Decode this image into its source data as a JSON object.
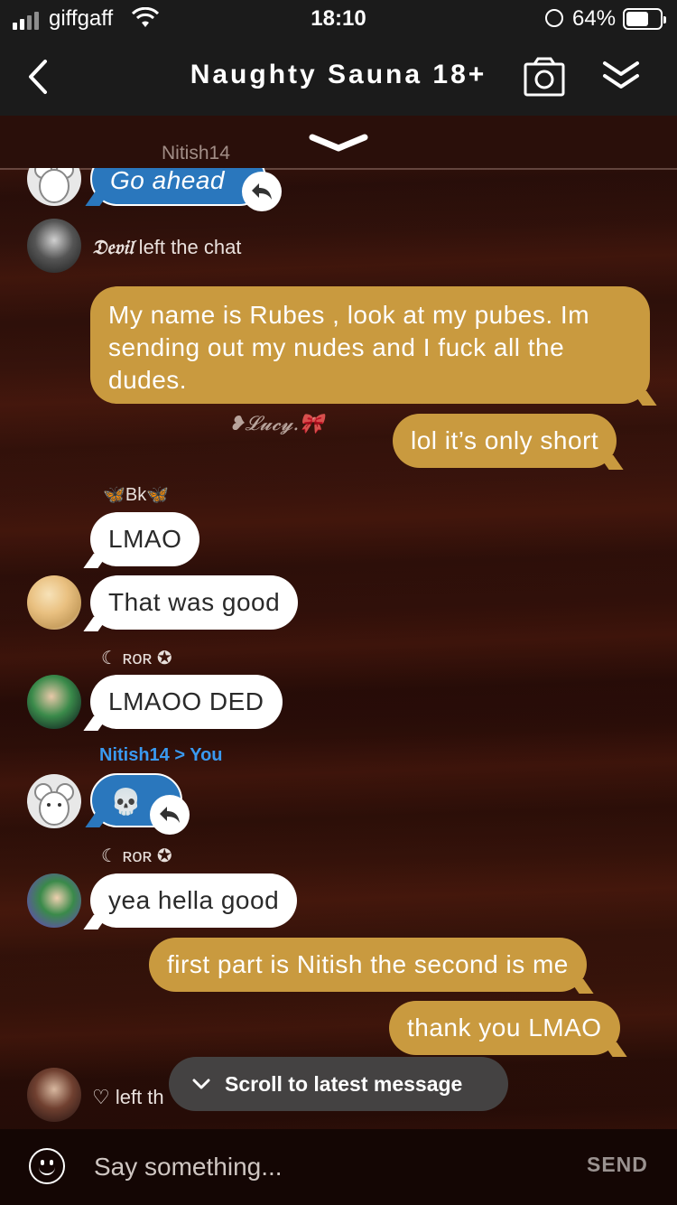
{
  "status_bar": {
    "carrier": "giffgaff",
    "time": "18:10",
    "battery": "64%"
  },
  "header": {
    "title": "Naughty Sauna 18+",
    "back_icon": "chevron-left-icon",
    "camera_icon": "camera-icon",
    "collapse_icon": "double-chevron-down-icon"
  },
  "pinned": {
    "name": "Nitish14"
  },
  "messages": {
    "m1": {
      "text": "Go ahead"
    },
    "m2": {
      "nick": "𝔇𝔢𝔳𝔦𝔩",
      "text": " left the chat"
    },
    "m3": {
      "text": "My name is Rubes , look at my pubes. Im sending out my nudes and I fuck all the dudes."
    },
    "m3_watermark": "❥𝓛𝓾𝓬𝔂.🎀",
    "m4": {
      "text": "lol it’s only short"
    },
    "m5": {
      "sender": "🦋Bk🦋",
      "text": "LMAO"
    },
    "m6": {
      "text": "That was good"
    },
    "m7": {
      "sender": "☾ ʀoʀ ✪",
      "text": "LMAOO DED"
    },
    "m8": {
      "sender": "Nitish14 > You",
      "text": "💀"
    },
    "m9": {
      "sender": "☾ ʀoʀ ✪",
      "text": "yea hella good"
    },
    "m10": {
      "text": "first part is Nitish the second is me"
    },
    "m11": {
      "text": "thank you LMAO"
    },
    "m12": {
      "text": "♡ left th"
    }
  },
  "scroll_pill": {
    "label": "Scroll to latest message"
  },
  "composer": {
    "placeholder": "Say something...",
    "send_label": "SEND"
  },
  "colors": {
    "gold_bubble": "#c99a3f",
    "blue_bubble": "#2a77bd",
    "header_bg": "#1b1b1b"
  }
}
